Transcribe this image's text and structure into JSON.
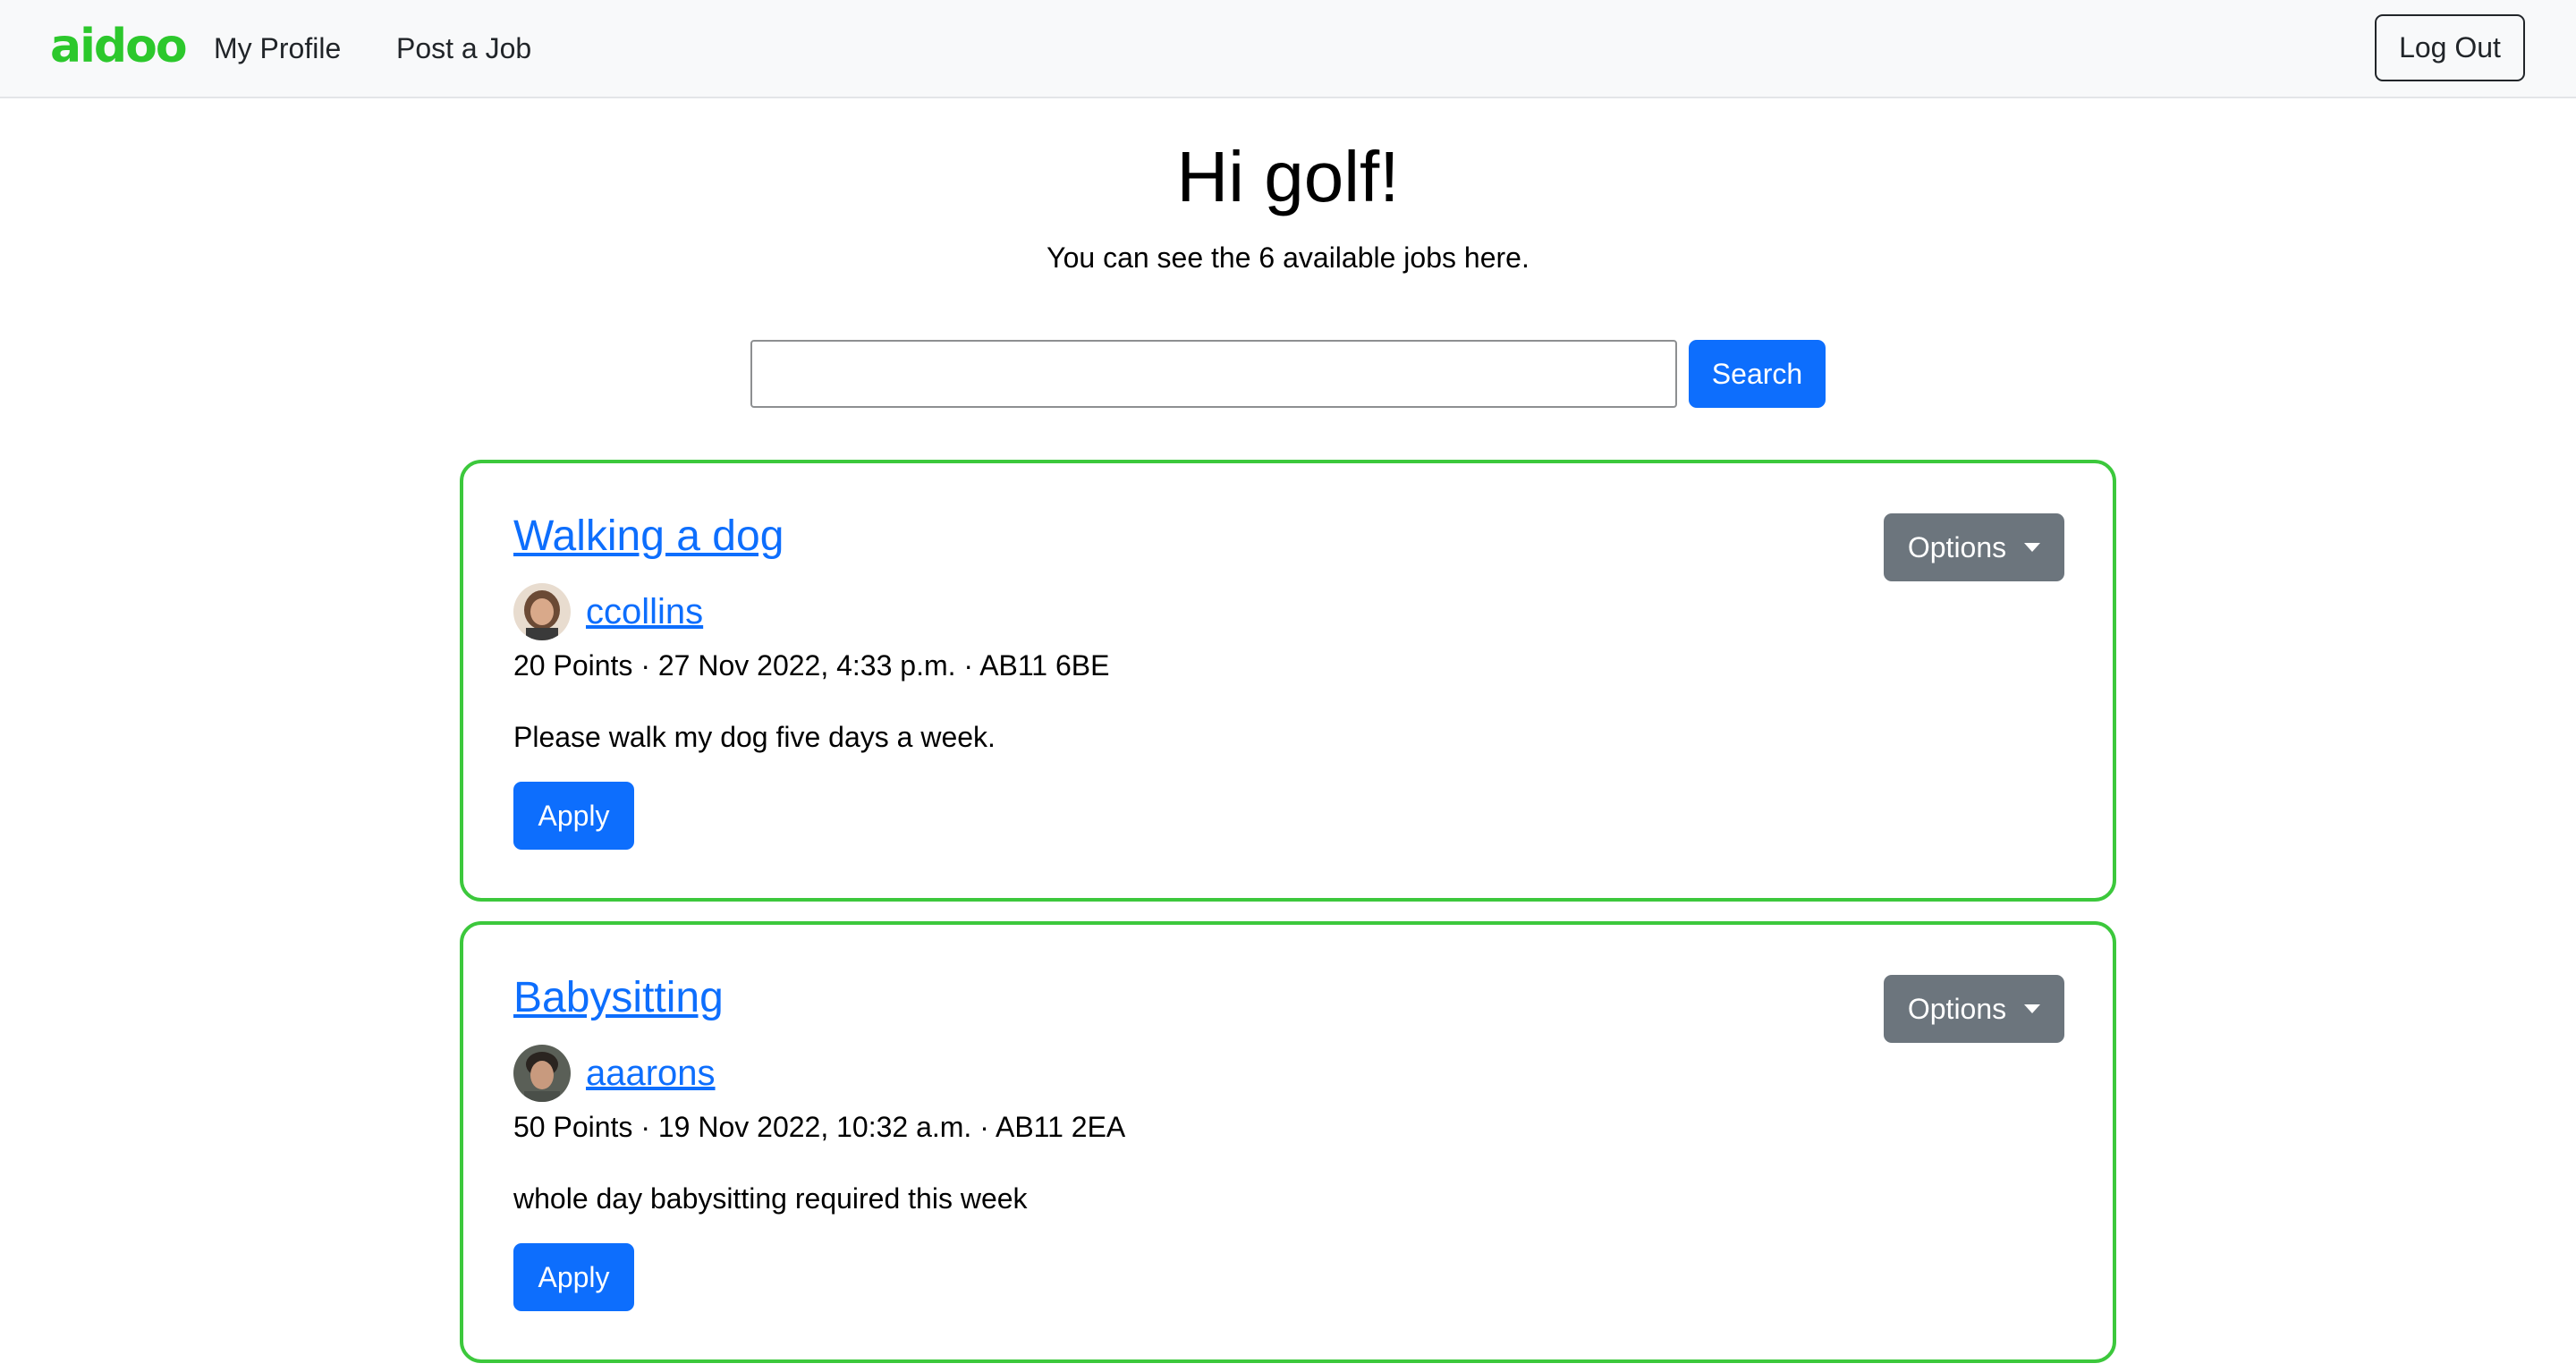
{
  "navbar": {
    "logo": "aidoo",
    "links": [
      "My Profile",
      "Post a Job"
    ],
    "logout": "Log Out"
  },
  "header": {
    "greeting": "Hi golf!",
    "subtitle": "You can see the 6 available jobs here."
  },
  "search": {
    "value": "",
    "placeholder": "",
    "button": "Search"
  },
  "jobs": [
    {
      "title": "Walking a dog",
      "poster": "ccollins",
      "meta": "20 Points · 27 Nov 2022, 4:33 p.m. · AB11 6BE",
      "description": "Please walk my dog five days a week.",
      "apply": "Apply",
      "options": "Options"
    },
    {
      "title": "Babysitting",
      "poster": "aaarons",
      "meta": "50 Points · 19 Nov 2022, 10:32 a.m. · AB11 2EA",
      "description": "whole day babysitting required this week",
      "apply": "Apply",
      "options": "Options"
    }
  ],
  "colors": {
    "brand": "#2cc82c",
    "primary": "#0d6efd",
    "secondary": "#6c757d",
    "card_border": "#3cc83c"
  },
  "icons": [
    "chevron-down-icon",
    "avatar"
  ]
}
